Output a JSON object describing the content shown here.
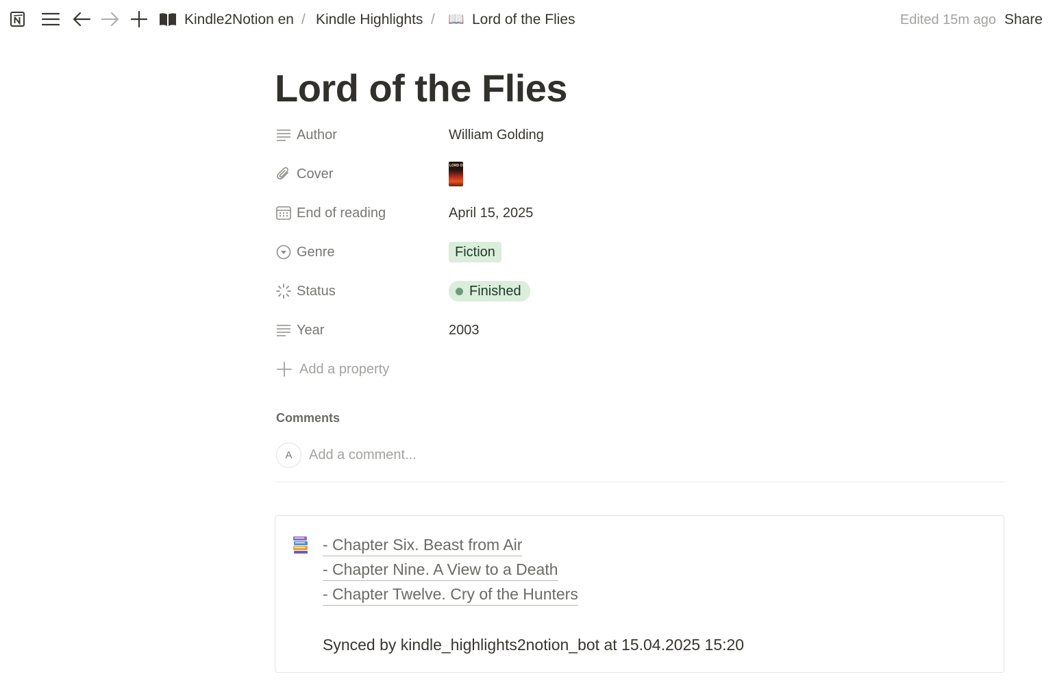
{
  "topbar": {
    "icons": [
      "notion-logo-icon",
      "menu-icon",
      "back-arrow-icon",
      "forward-arrow-icon",
      "plus-icon",
      "book-icon"
    ],
    "breadcrumbs": [
      {
        "label": "Kindle2Notion en"
      },
      {
        "label": "Kindle Highlights"
      },
      {
        "label": "Lord of the Flies",
        "icon": "📖"
      }
    ],
    "separator": "/",
    "edited": "Edited 15m ago",
    "share_label": "Share"
  },
  "page": {
    "title": "Lord of the Flies",
    "properties": {
      "author": {
        "name": "Author",
        "icon": "text-lines-icon",
        "value": "William Golding"
      },
      "cover": {
        "name": "Cover",
        "icon": "paperclip-icon",
        "thumb_text": "LORD OF THE FLIES"
      },
      "end_of_reading": {
        "name": "End of reading",
        "icon": "calendar-icon",
        "value": "April 15, 2025"
      },
      "genre": {
        "name": "Genre",
        "icon": "select-circle-icon",
        "value": "Fiction",
        "color": "#dbeddb"
      },
      "status": {
        "name": "Status",
        "icon": "status-spinner-icon",
        "value": "Finished",
        "dot_color": "#6c9b7d",
        "color": "#dbeddb"
      },
      "year": {
        "name": "Year",
        "icon": "text-lines-icon",
        "value": "2003"
      }
    },
    "add_property_label": "Add a property",
    "comments": {
      "heading": "Comments",
      "avatar_letter": "A",
      "placeholder": "Add a comment..."
    },
    "callout": {
      "icon": "books-stack-icon",
      "chapters": [
        "- Chapter Six. Beast from Air",
        "- Chapter Nine. A View to a Death",
        "- Chapter Twelve. Cry of the Hunters"
      ],
      "synced_text": "Synced by kindle_highlights2notion_bot at 15.04.2025 15:20"
    }
  }
}
